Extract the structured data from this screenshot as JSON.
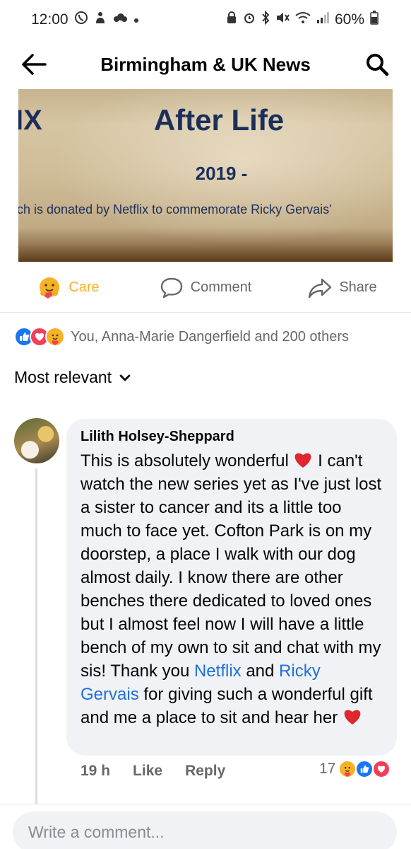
{
  "status_bar": {
    "time": "12:00",
    "battery": "60%"
  },
  "header": {
    "title": "Birmingham & UK News"
  },
  "post_image": {
    "left_fragment": "IX",
    "title": "After Life",
    "year": "2019 -",
    "caption": "ch is donated by Netflix to commemorate Ricky Gervais'"
  },
  "actions": {
    "care": "Care",
    "comment": "Comment",
    "share": "Share"
  },
  "reactions": {
    "summary": "You, Anna-Marie Dangerfield and 200 others"
  },
  "sort": {
    "label": "Most relevant"
  },
  "comment": {
    "author": "Lilith Holsey-Sheppard",
    "text_part1": "This is absolutely wonderful",
    "text_part2": " I can't watch the new series yet as I've just lost a sister to cancer and its a little too much to face yet. Cofton Park is on my doorstep, a place I walk with our dog almost daily. I know there are other benches there dedicated to loved ones but I almost feel now I will have a little bench of my own to sit and chat with my sis! Thank you ",
    "link1": "Netflix",
    "text_and": " and ",
    "link2": "Ricky Gervais",
    "text_part3": " for giving such a wonderful gift and me a place to sit and hear her",
    "time": "19 h",
    "like": "Like",
    "reply": "Reply",
    "reaction_count": "17"
  },
  "composer": {
    "placeholder": "Write a comment..."
  },
  "colors": {
    "link": "#216fdb",
    "like": "#1877f2",
    "love": "#f33e58",
    "care": "#f7b125"
  }
}
